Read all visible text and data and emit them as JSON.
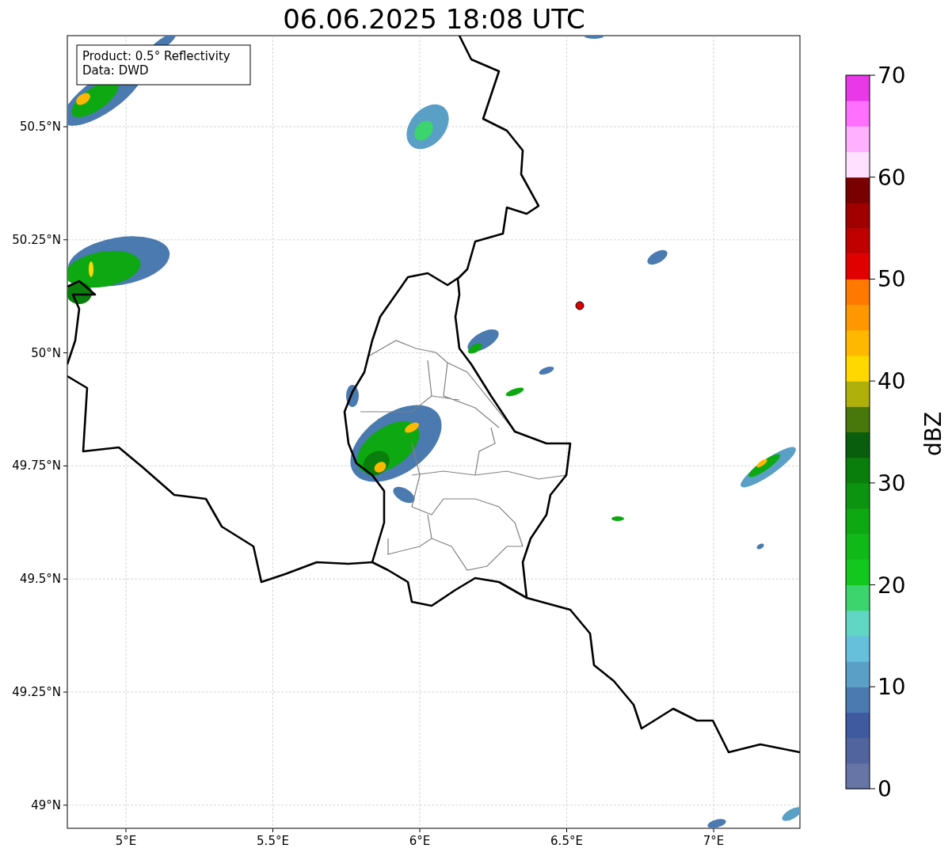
{
  "title": "06.06.2025 18:08 UTC",
  "legend": [
    "Product: 0.5° Reflectivity",
    "Data: DWD"
  ],
  "map": {
    "x_ticks": [
      "5°E",
      "5.5°E",
      "6°E",
      "6.5°E",
      "7°E"
    ],
    "y_ticks": [
      "50.5°N",
      "50.25°N",
      "50°N",
      "49.75°N",
      "49.5°N",
      "49.25°N",
      "49°N"
    ]
  },
  "colorbar": {
    "label": "dBZ",
    "ticks": [
      "70",
      "60",
      "50",
      "40",
      "30",
      "20",
      "10",
      "0"
    ],
    "segments": [
      {
        "color": "#6674a6"
      },
      {
        "color": "#52649e"
      },
      {
        "color": "#405aa0"
      },
      {
        "color": "#4a7ab0"
      },
      {
        "color": "#5a9fc6"
      },
      {
        "color": "#66c0dc"
      },
      {
        "color": "#62d6c4"
      },
      {
        "color": "#3cd46c"
      },
      {
        "color": "#12c81e"
      },
      {
        "color": "#10b818"
      },
      {
        "color": "#0ea812"
      },
      {
        "color": "#0c9410"
      },
      {
        "color": "#0a7e0c"
      },
      {
        "color": "#085e0c"
      },
      {
        "color": "#48780c"
      },
      {
        "color": "#b0b00a"
      },
      {
        "color": "#ffd800"
      },
      {
        "color": "#ffb800"
      },
      {
        "color": "#ff9800"
      },
      {
        "color": "#ff7800"
      },
      {
        "color": "#e00000"
      },
      {
        "color": "#c00000"
      },
      {
        "color": "#a00000"
      },
      {
        "color": "#780000"
      },
      {
        "color": "#ffe0ff"
      },
      {
        "color": "#ffb0ff"
      },
      {
        "color": "#ff70ff"
      },
      {
        "color": "#e838e8"
      }
    ]
  }
}
